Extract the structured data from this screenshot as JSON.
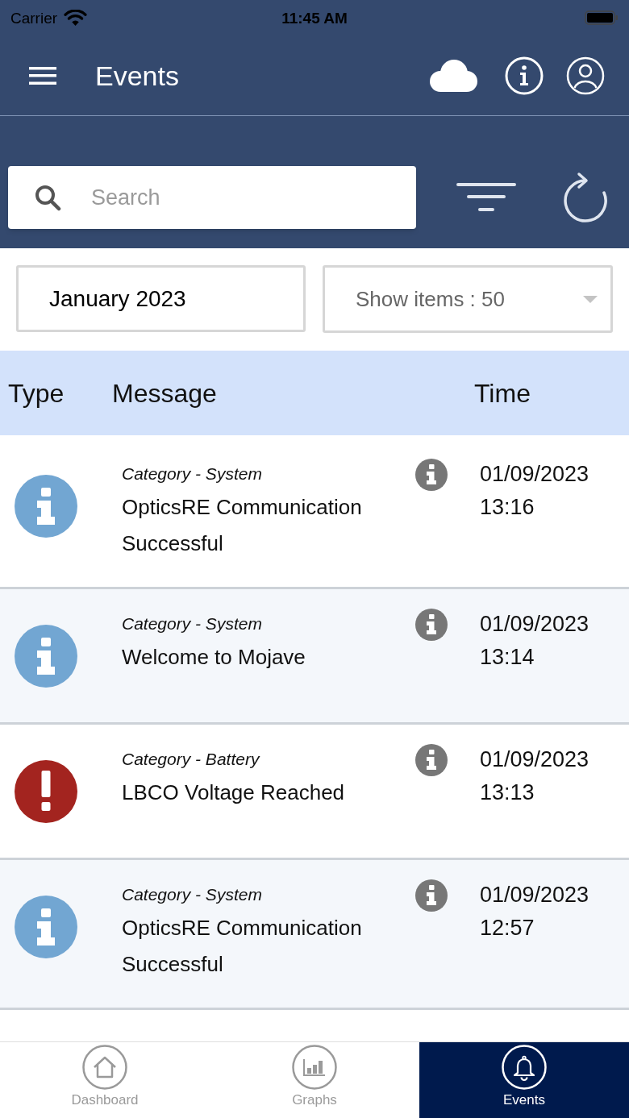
{
  "status_bar": {
    "carrier": "Carrier",
    "time": "11:45 AM"
  },
  "header": {
    "title": "Events"
  },
  "search": {
    "placeholder": "Search"
  },
  "filters": {
    "month": "January 2023",
    "show_items": "Show items : 50"
  },
  "table": {
    "columns": [
      "Type",
      "Message",
      "Time"
    ],
    "rows": [
      {
        "kind": "info",
        "category": "Category - System",
        "message": "OpticsRE Communication Successful",
        "date": "01/09/2023",
        "time": "13:16"
      },
      {
        "kind": "info",
        "category": "Category - System",
        "message": "Welcome to Mojave",
        "date": "01/09/2023",
        "time": "13:14"
      },
      {
        "kind": "alert",
        "category": "Category - Battery",
        "message": "LBCO Voltage Reached",
        "date": "01/09/2023",
        "time": "13:13"
      },
      {
        "kind": "info",
        "category": "Category - System",
        "message": "OpticsRE Communication Successful",
        "date": "01/09/2023",
        "time": "12:57"
      }
    ]
  },
  "tab_bar": {
    "tabs": [
      {
        "kind": "home",
        "label": "Dashboard",
        "selected": false
      },
      {
        "kind": "chart",
        "label": "Graphs",
        "selected": false
      },
      {
        "kind": "bell",
        "label": "Events",
        "selected": true
      }
    ]
  }
}
